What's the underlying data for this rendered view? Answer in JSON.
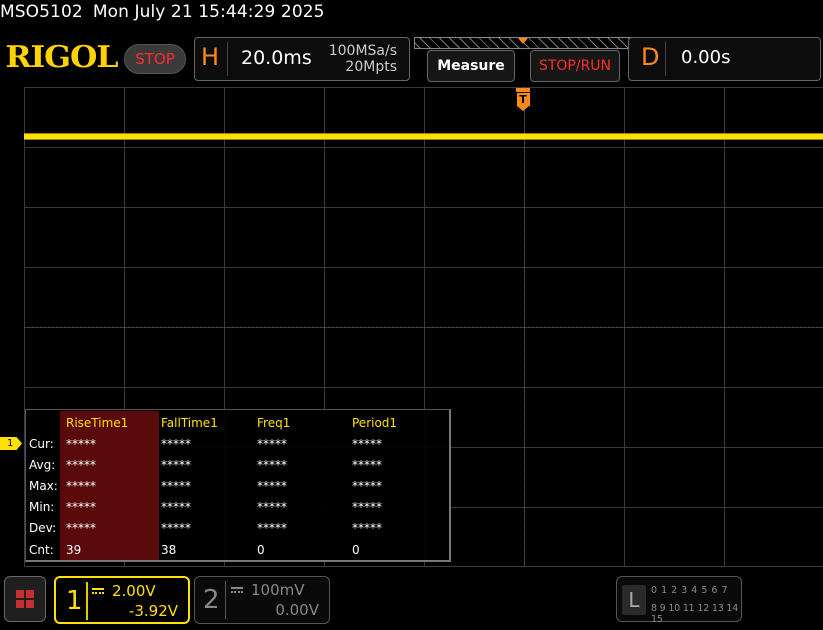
{
  "header": {
    "model": "MSO5102",
    "datetime": "Mon July 21 15:44:29 2025"
  },
  "topbar": {
    "logo": "RIGOL",
    "run_state": "STOP",
    "horizontal": {
      "letter": "H",
      "timebase": "20.0ms",
      "sample_rate": "100MSa/s",
      "memory_depth": "20Mpts"
    },
    "measure_label": "Measure",
    "stoprun_label": "STOP/RUN",
    "delay": {
      "letter": "D",
      "value": "0.00s"
    }
  },
  "screen": {
    "trigger_marker": "T",
    "ch1_marker": "1",
    "trace_color": "#ffe000"
  },
  "measurements": {
    "columns": [
      "RiseTime1",
      "FallTime1",
      "Freq1",
      "Period1"
    ],
    "rows": [
      {
        "label": "Cur:",
        "values": [
          "*****",
          "*****",
          "*****",
          "*****"
        ]
      },
      {
        "label": "Avg:",
        "values": [
          "*****",
          "*****",
          "*****",
          "*****"
        ]
      },
      {
        "label": "Max:",
        "values": [
          "*****",
          "*****",
          "*****",
          "*****"
        ]
      },
      {
        "label": "Min:",
        "values": [
          "*****",
          "*****",
          "*****",
          "*****"
        ]
      },
      {
        "label": "Dev:",
        "values": [
          "*****",
          "*****",
          "*****",
          "*****"
        ]
      },
      {
        "label": "Cnt:",
        "values": [
          "39",
          "38",
          "0",
          "0"
        ]
      }
    ]
  },
  "bottombar": {
    "ch1": {
      "num": "1",
      "scale": "2.00V",
      "offset": "-3.92V",
      "color": "#ffe000"
    },
    "ch2": {
      "num": "2",
      "scale": "100mV",
      "offset": "0.00V"
    },
    "logic": {
      "label": "L",
      "row1": "0 1 2 3  4 5 6 7",
      "row2": "8 9 10 11 12 13 14 15"
    }
  }
}
